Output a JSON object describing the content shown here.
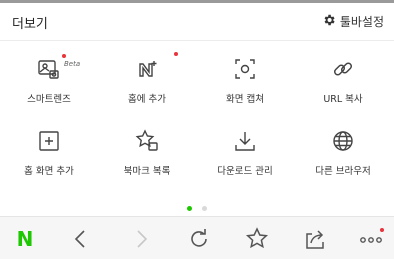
{
  "header": {
    "title": "더보기",
    "settings_label": "툴바설정"
  },
  "grid": {
    "items": [
      {
        "label": "스마트렌즈",
        "icon": "smart-lens-icon",
        "badge": "Beta",
        "new_dot": true
      },
      {
        "label": "홈에 추가",
        "icon": "add-to-naver-home-icon",
        "new_dot": true
      },
      {
        "label": "화면 캡쳐",
        "icon": "screen-capture-icon"
      },
      {
        "label": "URL 복사",
        "icon": "link-icon"
      },
      {
        "label": "홈 화면 추가",
        "icon": "add-home-screen-icon"
      },
      {
        "label": "북마크 복록",
        "icon": "bookmark-star-icon"
      },
      {
        "label": "다운로드 관리",
        "icon": "download-icon"
      },
      {
        "label": "다른 브라우저",
        "icon": "globe-icon"
      }
    ]
  },
  "pager": {
    "pages": 2,
    "current": 1
  },
  "bottom_bar": {
    "logo_text": "N",
    "items": [
      "naver-home-icon",
      "back-icon",
      "forward-icon",
      "refresh-icon",
      "bookmark-icon",
      "share-icon",
      "more-icon"
    ]
  },
  "colors": {
    "accent_green": "#1ec800",
    "red_dot": "#e8343c",
    "disabled_gray": "#c8c8c8"
  }
}
